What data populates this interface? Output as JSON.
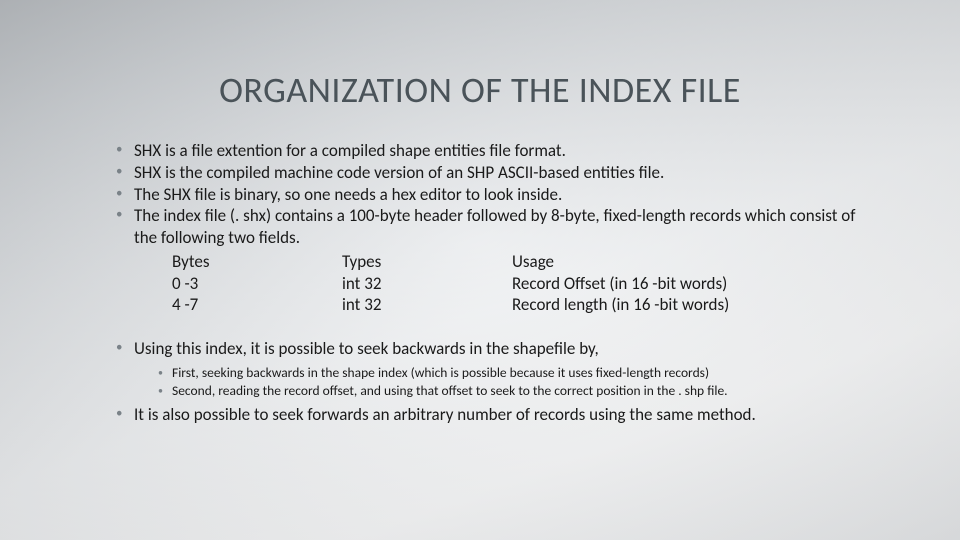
{
  "title": "ORGANIZATION OF THE INDEX FILE",
  "bullets": {
    "b1": "SHX is a file extention for a compiled shape entities file format.",
    "b2": "SHX is the compiled machine code version of an SHP ASCII-based entities file.",
    "b3": "The SHX file is binary, so one needs a hex editor to look inside.",
    "b4": "The index file (. shx) contains a 100-byte header followed by 8-byte, fixed-length records which consist of the following two fields.",
    "b5": "Using this index, it is possible to seek backwards in the shapefile by,",
    "b6": "It is also possible to seek forwards an arbitrary number of records using the same method."
  },
  "sub": {
    "s1": "First, seeking backwards in the shape index (which is possible because it uses fixed-length records)",
    "s2": "Second, reading the record offset, and using that offset to seek to the correct position in the . shp file."
  },
  "table": {
    "header": {
      "c1": "Bytes",
      "c2": "Types",
      "c3": "Usage"
    },
    "rows": [
      {
        "c1": "0 -3",
        "c2": "int 32",
        "c3": "Record Offset (in 16 -bit words)"
      },
      {
        "c1": "4 -7",
        "c2": "int 32",
        "c3": "Record length (in 16 -bit words)"
      }
    ]
  }
}
